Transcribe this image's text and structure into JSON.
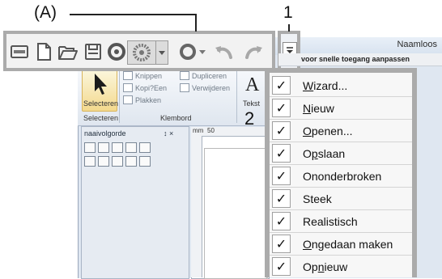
{
  "callouts": {
    "a": "(A)",
    "one": "1",
    "two": "2"
  },
  "window": {
    "title": "Naamloos",
    "ribbon": {
      "select_label": "Selecteren",
      "group_select": "Selecteren",
      "group_clipboard": "Klembord",
      "clipboard_items": [
        "Knippen",
        "Dupliceren",
        "Kopi?Een",
        "Verwijderen",
        "Plakken"
      ],
      "text_label": "Tekst",
      "text_glyph": "A"
    },
    "panel": {
      "title": "naaivolgorde",
      "pin": "↕ ×"
    },
    "ruler": {
      "mark": "50",
      "corner": "mm"
    }
  },
  "quick_access": {
    "icons": [
      "monitor-icon",
      "new-document-icon",
      "open-folder-icon",
      "save-icon",
      "stitch-icon",
      "realistic-icon",
      "dropdown-arrow-icon",
      "circle-icon",
      "undo-icon",
      "redo-icon"
    ]
  },
  "menu": {
    "title": "voor snelle toegang aanpassen",
    "check": "✓",
    "items": [
      {
        "pre": "",
        "acc": "W",
        "post": "izard..."
      },
      {
        "pre": "",
        "acc": "N",
        "post": "ieuw"
      },
      {
        "pre": "",
        "acc": "O",
        "post": "penen..."
      },
      {
        "pre": "O",
        "acc": "p",
        "post": "slaan"
      },
      {
        "pre": "Ononderbroken",
        "acc": "",
        "post": ""
      },
      {
        "pre": "Steek",
        "acc": "",
        "post": ""
      },
      {
        "pre": "Realistisch",
        "acc": "",
        "post": ""
      },
      {
        "pre": "",
        "acc": "O",
        "post": "ngedaan maken"
      },
      {
        "pre": "Op",
        "acc": "n",
        "post": "ieuw"
      }
    ]
  },
  "colors": {
    "frame": "#ababab",
    "accent": "#f3d98d"
  }
}
